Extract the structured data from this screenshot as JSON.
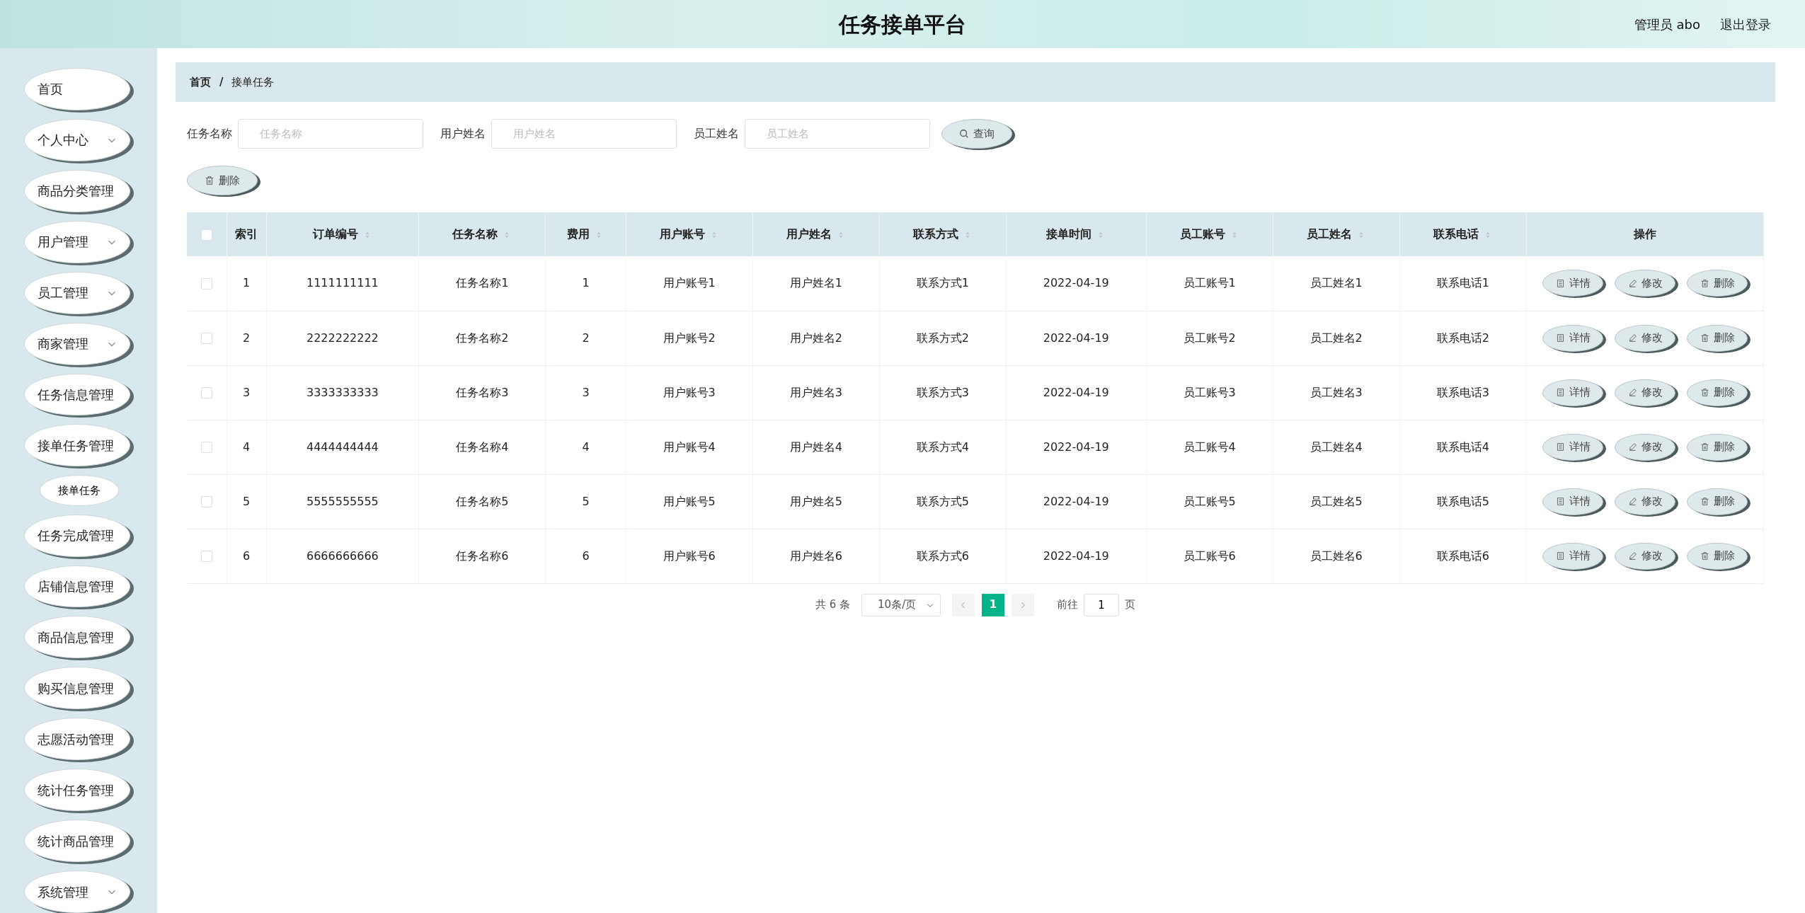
{
  "header": {
    "title": "任务接单平台",
    "user": "管理员 abo",
    "logout": "退出登录"
  },
  "sidebar": {
    "items": [
      {
        "label": "首页",
        "kind": "link",
        "expanded": false
      },
      {
        "label": "个人中心",
        "kind": "group",
        "expanded": false
      },
      {
        "label": "商品分类管理",
        "kind": "link",
        "expanded": false
      },
      {
        "label": "用户管理",
        "kind": "group",
        "expanded": false
      },
      {
        "label": "员工管理",
        "kind": "group",
        "expanded": false
      },
      {
        "label": "商家管理",
        "kind": "group",
        "expanded": false
      },
      {
        "label": "任务信息管理",
        "kind": "link",
        "expanded": false
      },
      {
        "label": "接单任务管理",
        "kind": "link",
        "expanded": true,
        "children": [
          {
            "label": "接单任务"
          }
        ]
      },
      {
        "label": "任务完成管理",
        "kind": "link",
        "expanded": false
      },
      {
        "label": "店铺信息管理",
        "kind": "link",
        "expanded": false
      },
      {
        "label": "商品信息管理",
        "kind": "link",
        "expanded": false
      },
      {
        "label": "购买信息管理",
        "kind": "link",
        "expanded": false
      },
      {
        "label": "志愿活动管理",
        "kind": "link",
        "expanded": false
      },
      {
        "label": "统计任务管理",
        "kind": "link",
        "expanded": false
      },
      {
        "label": "统计商品管理",
        "kind": "link",
        "expanded": false
      },
      {
        "label": "系统管理",
        "kind": "group",
        "expanded": false
      }
    ]
  },
  "breadcrumb": {
    "separator": "/",
    "items": [
      "首页",
      "接单任务"
    ]
  },
  "filters": [
    {
      "label": "任务名称",
      "placeholder": "任务名称"
    },
    {
      "label": "用户姓名",
      "placeholder": "用户姓名"
    },
    {
      "label": "员工姓名",
      "placeholder": "员工姓名"
    }
  ],
  "search_button": "查询",
  "bulk_delete": "删除",
  "table": {
    "select_all_checked": false,
    "columns": [
      {
        "label": "索引",
        "sortable": false
      },
      {
        "label": "订单编号",
        "sortable": true
      },
      {
        "label": "任务名称",
        "sortable": true
      },
      {
        "label": "费用",
        "sortable": true
      },
      {
        "label": "用户账号",
        "sortable": true
      },
      {
        "label": "用户姓名",
        "sortable": true
      },
      {
        "label": "联系方式",
        "sortable": true
      },
      {
        "label": "接单时间",
        "sortable": true
      },
      {
        "label": "员工账号",
        "sortable": true
      },
      {
        "label": "员工姓名",
        "sortable": true
      },
      {
        "label": "联系电话",
        "sortable": true
      },
      {
        "label": "操作",
        "sortable": false
      }
    ],
    "rows": [
      {
        "checked": false,
        "cells": [
          "1",
          "1111111111",
          "任务名称1",
          "1",
          "用户账号1",
          "用户姓名1",
          "联系方式1",
          "2022-04-19",
          "员工账号1",
          "员工姓名1",
          "联系电话1"
        ],
        "actions": [
          "详情",
          "修改",
          "删除"
        ]
      },
      {
        "checked": false,
        "cells": [
          "2",
          "2222222222",
          "任务名称2",
          "2",
          "用户账号2",
          "用户姓名2",
          "联系方式2",
          "2022-04-19",
          "员工账号2",
          "员工姓名2",
          "联系电话2"
        ],
        "actions": [
          "详情",
          "修改",
          "删除"
        ]
      },
      {
        "checked": false,
        "cells": [
          "3",
          "3333333333",
          "任务名称3",
          "3",
          "用户账号3",
          "用户姓名3",
          "联系方式3",
          "2022-04-19",
          "员工账号3",
          "员工姓名3",
          "联系电话3"
        ],
        "actions": [
          "详情",
          "修改",
          "删除"
        ]
      },
      {
        "checked": false,
        "cells": [
          "4",
          "4444444444",
          "任务名称4",
          "4",
          "用户账号4",
          "用户姓名4",
          "联系方式4",
          "2022-04-19",
          "员工账号4",
          "员工姓名4",
          "联系电话4"
        ],
        "actions": [
          "详情",
          "修改",
          "删除"
        ]
      },
      {
        "checked": false,
        "cells": [
          "5",
          "5555555555",
          "任务名称5",
          "5",
          "用户账号5",
          "用户姓名5",
          "联系方式5",
          "2022-04-19",
          "员工账号5",
          "员工姓名5",
          "联系电话5"
        ],
        "actions": [
          "详情",
          "修改",
          "删除"
        ]
      },
      {
        "checked": false,
        "cells": [
          "6",
          "6666666666",
          "任务名称6",
          "6",
          "用户账号6",
          "用户姓名6",
          "联系方式6",
          "2022-04-19",
          "员工账号6",
          "员工姓名6",
          "联系电话6"
        ],
        "actions": [
          "详情",
          "修改",
          "删除"
        ]
      }
    ]
  },
  "pagination": {
    "total": "共 6 条",
    "page_size": "10条/页",
    "pages": [
      {
        "label": "1",
        "selected": true
      }
    ],
    "goto_label": "前往",
    "goto_value": "1",
    "goto_suffix": "页"
  }
}
